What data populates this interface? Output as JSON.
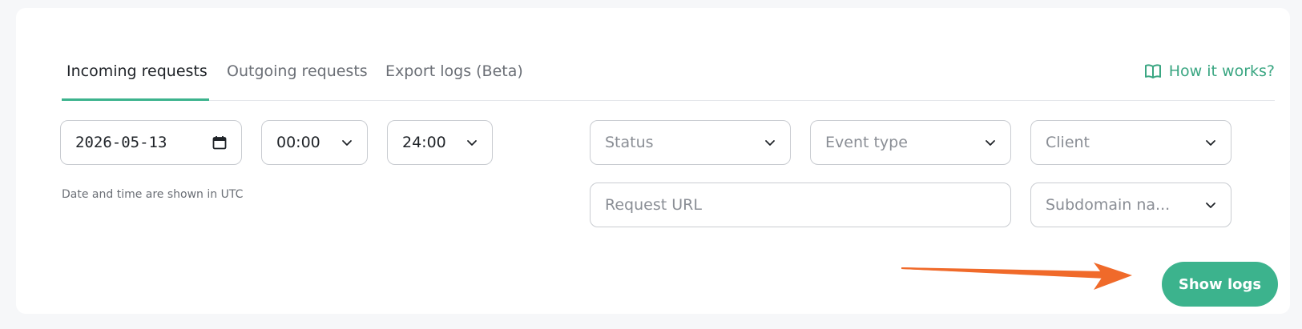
{
  "tabs": [
    {
      "label": "Incoming requests",
      "active": true
    },
    {
      "label": "Outgoing requests",
      "active": false
    },
    {
      "label": "Export logs (Beta)",
      "active": false
    }
  ],
  "help_link": {
    "label": "How it works?",
    "icon": "book-icon"
  },
  "filters": {
    "date": "2026-05-13",
    "start_time": "00:00",
    "end_time": "24:00",
    "status_placeholder": "Status",
    "event_type_placeholder": "Event type",
    "client_placeholder": "Client",
    "request_url_placeholder": "Request URL",
    "subdomain_placeholder": "Subdomain na..."
  },
  "timezone_note": "Date and time are shown in UTC",
  "show_logs_label": "Show logs",
  "colors": {
    "accent": "#3cb38d",
    "arrow": "#f06a2a",
    "link": "#3aa682"
  }
}
